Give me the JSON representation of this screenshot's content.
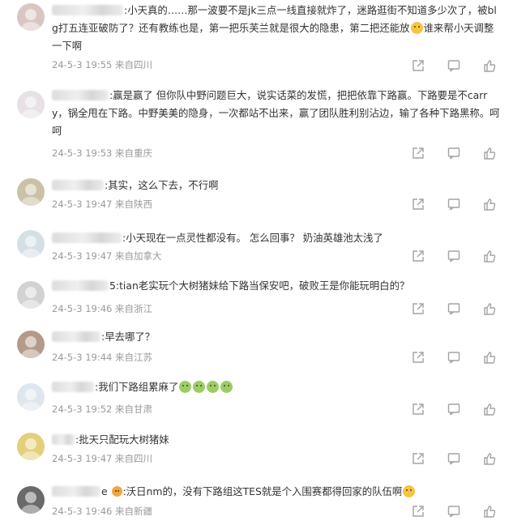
{
  "comments": [
    {
      "name_width": 88,
      "sep": ":",
      "text_parts": [
        "小天真的……那一波要不是jk三点一线直接就炸了，迷路逛街不知道多少次了，被blg打五连亚破防了？还有教练也是，第一把乐芙兰就是很大的隐患，第二把还能放",
        "谁来帮小天调整一下啊"
      ],
      "emoji_count": 1,
      "emoji_color": "yellow",
      "date": "24-5-3 19:55",
      "location": "来自四川"
    },
    {
      "name_width": 70,
      "sep": ":",
      "text_parts": [
        "赢是赢了 但你队中野问题巨大，说实话菜的发慌，把把依靠下路赢。下路要是不carry，锅全甩在下路。中野美美的隐身，一次都站不出来，赢了团队胜利别沾边，输了各种下路黑称。呵呵"
      ],
      "emoji_count": 0,
      "emoji_color": "",
      "date": "24-5-3 19:53",
      "location": "来自重庆"
    },
    {
      "name_width": 64,
      "sep": ":",
      "text_parts": [
        "其实，这么下去，不行啊"
      ],
      "emoji_count": 0,
      "emoji_color": "",
      "date": "24-5-3 19:47",
      "location": "来自陕西"
    },
    {
      "name_width": 86,
      "sep": ":",
      "text_parts": [
        "小天现在一点灵性都没有。 怎么回事？ 奶油英雄池太浅了"
      ],
      "emoji_count": 0,
      "emoji_color": "",
      "date": "24-5-3 19:47",
      "location": "来自加拿大"
    },
    {
      "name_width": 70,
      "sep": "5:",
      "text_parts": [
        "tian老实玩个大树猪妹给下路当保安吧，破败王是你能玩明白的？"
      ],
      "emoji_count": 0,
      "emoji_color": "",
      "date": "24-5-3 19:46",
      "location": "来自浙江"
    },
    {
      "name_width": 60,
      "sep": ":",
      "text_parts": [
        "早去哪了？"
      ],
      "emoji_count": 0,
      "emoji_color": "",
      "date": "24-5-3 19:44",
      "location": "来自江苏"
    },
    {
      "name_width": 52,
      "sep": ":",
      "text_parts": [
        "我们下路组累麻了",
        ""
      ],
      "emoji_count": 4,
      "emoji_color": "green",
      "date": "24-5-3 19:52",
      "location": "来自甘肃"
    },
    {
      "name_width": 28,
      "sep": ":",
      "text_parts": [
        "批天只配玩大树猪妹"
      ],
      "emoji_count": 0,
      "emoji_color": "",
      "date": "24-5-3 19:47",
      "location": "来自四川"
    },
    {
      "name_width": 60,
      "sep": ":",
      "text_parts": [
        "沃日nm的，没有下路组这TES就是个入围赛都得回家的队伍啊",
        ""
      ],
      "emoji_count": 1,
      "emoji_color": "yellow",
      "badge": "e",
      "date": "24-5-3 19:46",
      "location": "来自新疆"
    }
  ]
}
